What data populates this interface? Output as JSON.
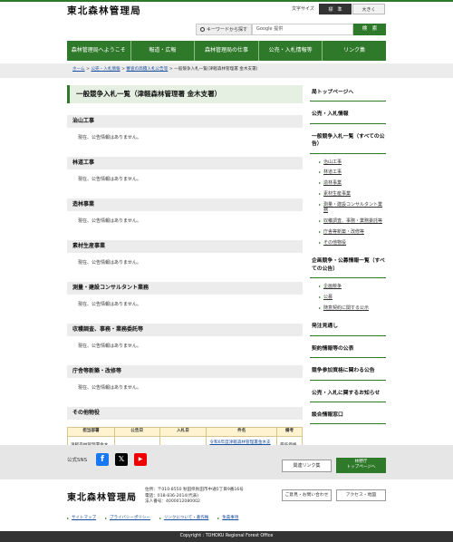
{
  "header": {
    "logo": "東北森林管理局",
    "font_size_label": "文字サイズ",
    "font_size_standard": "標　準",
    "font_size_large": "大きく",
    "search_label": "キーワードから探す",
    "search_placeholder": "Google 提供",
    "search_button": "検　索"
  },
  "gnav": [
    "森林管理局へようこそ",
    "報道・広報",
    "森林管理局の仕事",
    "公売・入札情報等",
    "リンク集"
  ],
  "breadcrumb": {
    "items": [
      "ホーム",
      "公売・入札情報",
      "審査の高積入札公告等"
    ],
    "current": "一般競争入札一覧(津軽森林管理署 金木支署)",
    "sep": " > "
  },
  "main": {
    "title": "一般競争入札一覧（津軽森林管理署 金木支署）",
    "no_info": "現在、公告情報はありません。",
    "sections": [
      "治山工事",
      "林道工事",
      "造林事業",
      "素材生産事業",
      "測量・建設コンサルタント業務",
      "収穫調査、事務・業務委託等",
      "庁舎等新築・改修等"
    ],
    "last_section": "その他物役",
    "table": {
      "headers": [
        "担当部署",
        "公告日",
        "入札日",
        "件名",
        "備考"
      ],
      "rows": [
        {
          "dept": "津軽森林管理署金木支署",
          "notice": "令和6年2月19日",
          "bid": "令和6年3月15日",
          "subject": "令和6年度津軽森林管理署金木支署油類単価契約（金木・喜良市地区）",
          "note": "最低価格落札方式"
        }
      ]
    }
  },
  "sidebar": {
    "top": "局トップページへ",
    "bids": "公売・入札情報",
    "all_general": "一般競争入札一覧（すべての公告）",
    "general_items": [
      "治山工事",
      "林道工事",
      "造林事業",
      "素材生産事業",
      "測量・建設コンサルタント業務",
      "収穫調査、事務・業務委託等",
      "庁舎等新築・改修等",
      "その他物役"
    ],
    "planning": "企画競争・公募情報一覧（すべての公告）",
    "planning_items": [
      "企画競争",
      "公募",
      "随意契約に関する公示"
    ],
    "order_outlook": "発注見通し",
    "contracts": "契約情報等の公表",
    "qualification": "競争参加資格に関わる公告",
    "notices": "公売・入札に関するお知らせ",
    "window": "談合情報窓口"
  },
  "footer": {
    "sns_label": "公式SNS",
    "fb_glyph": "f",
    "x_glyph": "𝕏",
    "yt_glyph": "▶",
    "related_links": "関連リンク集",
    "forest_top_1": "林野庁",
    "forest_top_2": "トップページへ",
    "logo": "東北森林管理局",
    "address": "住所：〒010-8550 秋田県秋田市中通5丁目9番16号",
    "phone": "電話：018-836-2014(代表)",
    "corp_no": "法人番号：4000012080002",
    "contact": "ご意見・お問い合わせ",
    "access": "アクセス・地図",
    "links": [
      "サイトマップ",
      "プライバシーポリシー",
      "リンクについて・著作権",
      "免責事項"
    ],
    "copyright": "Copyright : TOHOKU Regional Forest Office"
  },
  "colors": {
    "accent": "#2f7a2a",
    "link": "#1a4fa0",
    "table_header": "#fff3d0"
  }
}
